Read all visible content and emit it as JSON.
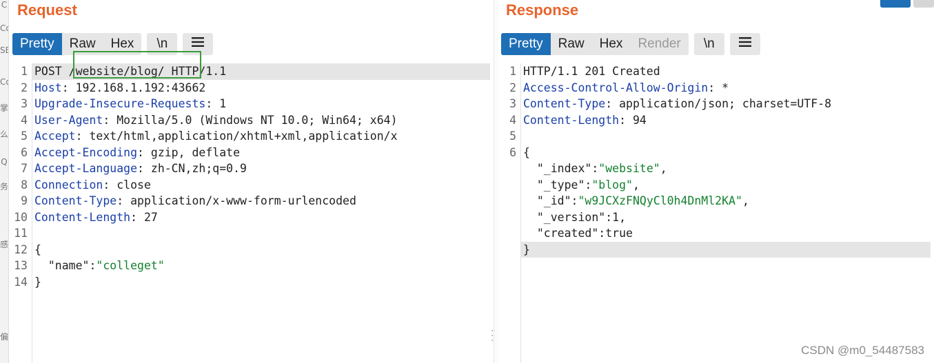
{
  "request": {
    "title": "Request",
    "tabs": [
      "Pretty",
      "Raw",
      "Hex"
    ],
    "newline_btn": "\\n",
    "lines": [
      {
        "n": "1",
        "parts": [
          {
            "t": "POST /website/blog/ HTTP/1.1",
            "c": "plain"
          }
        ]
      },
      {
        "n": "2",
        "parts": [
          {
            "t": "Host",
            "c": "hn"
          },
          {
            "t": ": 192.168.1.192:43662",
            "c": "plain"
          }
        ]
      },
      {
        "n": "3",
        "parts": [
          {
            "t": "Upgrade-Insecure-Requests",
            "c": "hn"
          },
          {
            "t": ": 1",
            "c": "plain"
          }
        ]
      },
      {
        "n": "4",
        "parts": [
          {
            "t": "User-Agent",
            "c": "hn"
          },
          {
            "t": ": Mozilla/5.0 (Windows NT 10.0; Win64; x64)",
            "c": "plain"
          }
        ]
      },
      {
        "n": "5",
        "parts": [
          {
            "t": "Accept",
            "c": "hn"
          },
          {
            "t": ": text/html,application/xhtml+xml,application/x",
            "c": "plain"
          }
        ]
      },
      {
        "n": "6",
        "parts": [
          {
            "t": "Accept-Encoding",
            "c": "hn"
          },
          {
            "t": ": gzip, deflate",
            "c": "plain"
          }
        ]
      },
      {
        "n": "7",
        "parts": [
          {
            "t": "Accept-Language",
            "c": "hn"
          },
          {
            "t": ": zh-CN,zh;q=0.9",
            "c": "plain"
          }
        ]
      },
      {
        "n": "8",
        "parts": [
          {
            "t": "Connection",
            "c": "hn"
          },
          {
            "t": ": close",
            "c": "plain"
          }
        ]
      },
      {
        "n": "9",
        "parts": [
          {
            "t": "Content-Type",
            "c": "hn"
          },
          {
            "t": ": application/x-www-form-urlencoded",
            "c": "plain"
          }
        ]
      },
      {
        "n": "10",
        "parts": [
          {
            "t": "Content-Length",
            "c": "hn"
          },
          {
            "t": ": 27",
            "c": "plain"
          }
        ]
      },
      {
        "n": "11",
        "parts": []
      },
      {
        "n": "12",
        "parts": [
          {
            "t": "{",
            "c": "plain"
          }
        ]
      },
      {
        "n": "13",
        "parts": [
          {
            "t": "  \"name\"",
            "c": "jkey"
          },
          {
            "t": ":",
            "c": "plain"
          },
          {
            "t": "\"colleget\"",
            "c": "jstr"
          }
        ]
      },
      {
        "n": "14",
        "parts": [
          {
            "t": "}",
            "c": "plain"
          }
        ]
      }
    ]
  },
  "response": {
    "title": "Response",
    "tabs": [
      "Pretty",
      "Raw",
      "Hex",
      "Render"
    ],
    "newline_btn": "\\n",
    "lines": [
      {
        "n": "1",
        "parts": [
          {
            "t": "HTTP/1.1 201 Created",
            "c": "plain"
          }
        ]
      },
      {
        "n": "2",
        "parts": [
          {
            "t": "Access-Control-Allow-Origin",
            "c": "hn"
          },
          {
            "t": ": *",
            "c": "plain"
          }
        ]
      },
      {
        "n": "3",
        "parts": [
          {
            "t": "Content-Type",
            "c": "hn"
          },
          {
            "t": ": application/json; charset=UTF-8",
            "c": "plain"
          }
        ]
      },
      {
        "n": "4",
        "parts": [
          {
            "t": "Content-Length",
            "c": "hn"
          },
          {
            "t": ": 94",
            "c": "plain"
          }
        ]
      },
      {
        "n": "5",
        "parts": []
      },
      {
        "n": "6",
        "parts": [
          {
            "t": "{",
            "c": "plain"
          }
        ]
      },
      {
        "n": "",
        "parts": [
          {
            "t": "  \"_index\"",
            "c": "jkey"
          },
          {
            "t": ":",
            "c": "plain"
          },
          {
            "t": "\"website\"",
            "c": "jstr"
          },
          {
            "t": ",",
            "c": "plain"
          }
        ]
      },
      {
        "n": "",
        "parts": [
          {
            "t": "  \"_type\"",
            "c": "jkey"
          },
          {
            "t": ":",
            "c": "plain"
          },
          {
            "t": "\"blog\"",
            "c": "jstr"
          },
          {
            "t": ",",
            "c": "plain"
          }
        ]
      },
      {
        "n": "",
        "parts": [
          {
            "t": "  \"_id\"",
            "c": "jkey"
          },
          {
            "t": ":",
            "c": "plain"
          },
          {
            "t": "\"w9JCXzFNQyCl0h4DnMl2KA\"",
            "c": "jstr"
          },
          {
            "t": ",",
            "c": "plain"
          }
        ]
      },
      {
        "n": "",
        "parts": [
          {
            "t": "  \"_version\"",
            "c": "jkey"
          },
          {
            "t": ":1,",
            "c": "plain"
          }
        ]
      },
      {
        "n": "",
        "parts": [
          {
            "t": "  \"created\"",
            "c": "jkey"
          },
          {
            "t": ":true",
            "c": "plain"
          }
        ]
      },
      {
        "n": "",
        "parts": [
          {
            "t": "}",
            "c": "plain"
          }
        ]
      }
    ]
  },
  "left_strip_chars": [
    "C",
    "Co",
    "SE",
    "Co",
    "掌",
    "么",
    "Q",
    "务",
    "感",
    "偏"
  ],
  "watermark": "CSDN @m0_54487583",
  "colors": {
    "accent_title": "#e8642c",
    "active_tab": "#1e6fb6",
    "header_name": "#1a3fa8",
    "json_string": "#14812f",
    "highlight_box": "#3c9b3c"
  }
}
